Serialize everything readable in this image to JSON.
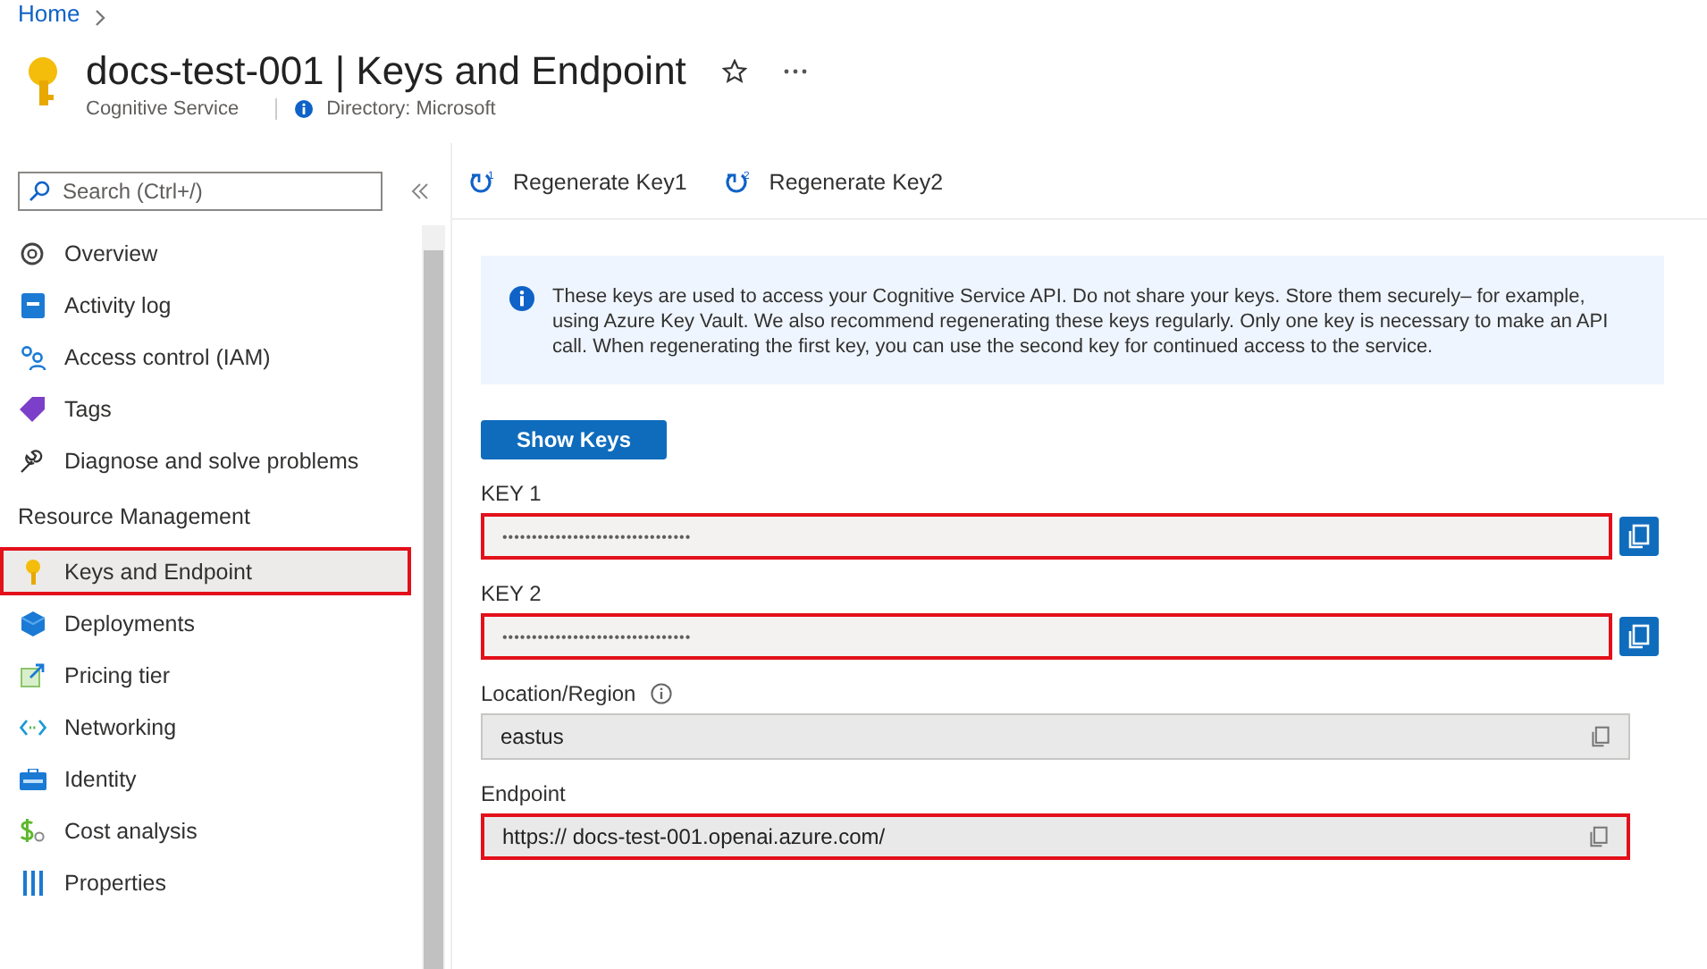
{
  "breadcrumb": {
    "items": [
      "Home"
    ]
  },
  "header": {
    "title": "docs-test-001 | Keys and Endpoint",
    "subtitle": "Cognitive Service",
    "directory": "Directory: Microsoft"
  },
  "search": {
    "placeholder": "Search (Ctrl+/)"
  },
  "sidebar": {
    "items": [
      {
        "kind": "item",
        "label": "Overview",
        "selected": false
      },
      {
        "kind": "item",
        "label": "Activity log",
        "selected": false
      },
      {
        "kind": "item",
        "label": "Access control (IAM)",
        "selected": false
      },
      {
        "kind": "item",
        "label": "Tags",
        "selected": false
      },
      {
        "kind": "item",
        "label": "Diagnose and solve problems",
        "selected": false
      },
      {
        "kind": "heading",
        "label": "Resource Management"
      },
      {
        "kind": "item",
        "label": "Keys and Endpoint",
        "selected": true
      },
      {
        "kind": "item",
        "label": "Deployments",
        "selected": false
      },
      {
        "kind": "item",
        "label": "Pricing tier",
        "selected": false
      },
      {
        "kind": "item",
        "label": "Networking",
        "selected": false
      },
      {
        "kind": "item",
        "label": "Identity",
        "selected": false
      },
      {
        "kind": "item",
        "label": "Cost analysis",
        "selected": false
      },
      {
        "kind": "item",
        "label": "Properties",
        "selected": false
      }
    ]
  },
  "toolbar": {
    "buttons": [
      {
        "label": "Regenerate Key1",
        "badge": "1"
      },
      {
        "label": "Regenerate Key2",
        "badge": "2"
      }
    ]
  },
  "info": {
    "text": "These keys are used to access your Cognitive Service API. Do not share your keys. Store them securely– for example, using Azure Key Vault. We also recommend regenerating these keys regularly. Only one key is necessary to make an API call. When regenerating the first key, you can use the second key for continued access to the service."
  },
  "show_keys_button": {
    "label": "Show Keys"
  },
  "fields": [
    {
      "kind": "secret",
      "label": "KEY 1",
      "value": "••••••••••••••••••••••••••••••••",
      "highlighted": true
    },
    {
      "kind": "secret",
      "label": "KEY 2",
      "value": "••••••••••••••••••••••••••••••••",
      "highlighted": true
    },
    {
      "kind": "plain",
      "label": "Location/Region",
      "value": "eastus",
      "info": true,
      "highlighted": false
    },
    {
      "kind": "plain",
      "label": "Endpoint",
      "value": "https://  docs-test-001.openai.azure.com/",
      "info": false,
      "highlighted": true
    }
  ]
}
